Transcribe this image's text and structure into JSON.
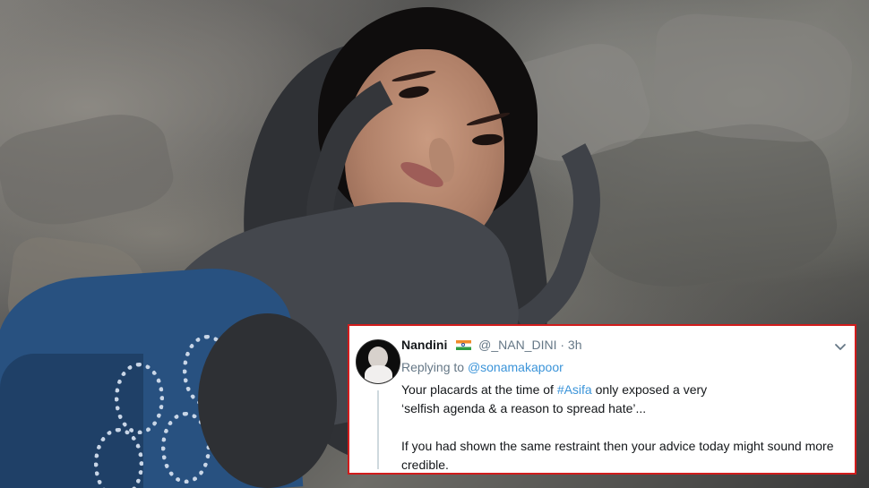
{
  "tweet": {
    "name": "Nandini",
    "handle": "@_NAN_DINI",
    "separator": "·",
    "time": "3h",
    "reply_prefix": "Replying to",
    "reply_handle": "@sonamakapoor",
    "line1_prefix": "Your placards at the time of",
    "hashtag": "#Asifa",
    "line1_suffix": "only exposed a very",
    "line2": "‘selfish agenda & a reason to spread hate’...",
    "line3": "If you had shown the same restraint then your advice today might sound more",
    "line4": "credible."
  },
  "icons": {
    "flag": "india-flag-icon",
    "menu": "chevron-down-icon",
    "avatar": "profile-avatar"
  },
  "colors": {
    "accent": "#3b94d9",
    "name_text": "#14171a",
    "muted_text": "#657786",
    "highlight_border": "#d11c1c"
  }
}
